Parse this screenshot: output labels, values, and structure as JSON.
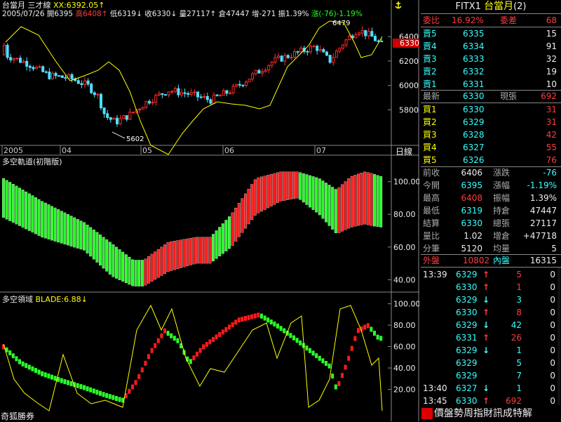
{
  "header": {
    "name": "台當月",
    "indicator": "三才線",
    "xx_label": "XX:",
    "xx_value": "6392.05",
    "date": "2005/07/26",
    "open_label": "開",
    "open": "6395",
    "high_label": "高",
    "high": "6408",
    "low_label": "低",
    "low": "6319",
    "close_label": "收",
    "close": "6330",
    "vol_label": "量",
    "vol": "27117",
    "oi_label": "倉",
    "oi": "47447",
    "oi_chg_label": "增",
    "oi_chg": "-271",
    "amp_label": "振",
    "amp": "1.39%",
    "chg_label": "漲",
    "chg": "(-76)",
    "chg_pct": "-1.19%",
    "up_arrow": "↑",
    "down_arrow": "↓"
  },
  "top_icon": "anchor-icon",
  "main_chart": {
    "y_ticks": [
      "6400",
      "6200",
      "6000",
      "5800"
    ],
    "price_tag": "6330",
    "high_note": "6479",
    "low_note": "5602",
    "x_labels": [
      "2005",
      "04",
      "05",
      "06",
      "07"
    ],
    "period_label": "日線"
  },
  "mid_chart": {
    "title": "多空軌道(初階版)",
    "y_ticks": [
      "100.00",
      "80.00",
      "60.00",
      "40.00"
    ]
  },
  "low_chart": {
    "title": "多空領域",
    "blade_label": "BLADE:6.88",
    "blade_arrow": "↓",
    "y_ticks": [
      "100.00",
      "80.00",
      "60.00",
      "40.00",
      "20.00"
    ],
    "footer": "奇狐勝券"
  },
  "quote": {
    "symbol": "FITX1",
    "name": "台當月",
    "count": "(2)",
    "ratio_label": "委比",
    "ratio": "16.92%",
    "diff_label": "委差",
    "diff": "68",
    "asks": [
      {
        "label": "賣5",
        "price": "6335",
        "vol": "15"
      },
      {
        "label": "賣4",
        "price": "6334",
        "vol": "91"
      },
      {
        "label": "賣3",
        "price": "6333",
        "vol": "32"
      },
      {
        "label": "賣2",
        "price": "6332",
        "vol": "19"
      },
      {
        "label": "賣1",
        "price": "6331",
        "vol": "10"
      }
    ],
    "last_label": "最新",
    "last": "6330",
    "now_label": "現張",
    "now": "692",
    "bids": [
      {
        "label": "買1",
        "price": "6330",
        "vol": "31"
      },
      {
        "label": "買2",
        "price": "6329",
        "vol": "31"
      },
      {
        "label": "買3",
        "price": "6328",
        "vol": "42"
      },
      {
        "label": "買4",
        "price": "6327",
        "vol": "55"
      },
      {
        "label": "買5",
        "price": "6326",
        "vol": "76"
      }
    ],
    "stats": [
      {
        "l1": "前收",
        "v1": "6406",
        "c1": "white",
        "l2": "漲跌",
        "v2": "-76",
        "c2": "cyan"
      },
      {
        "l1": "今開",
        "v1": "6395",
        "c1": "cyan",
        "l2": "漲幅",
        "v2": "-1.19%",
        "c2": "cyan"
      },
      {
        "l1": "最高",
        "v1": "6408",
        "c1": "red",
        "l2": "振幅",
        "v2": "1.39%",
        "c2": "white"
      },
      {
        "l1": "最低",
        "v1": "6319",
        "c1": "cyan",
        "l2": "持倉",
        "v2": "47447",
        "c2": "white"
      },
      {
        "l1": "結算",
        "v1": "6330",
        "c1": "cyan",
        "l2": "總張",
        "v2": "27117",
        "c2": "white"
      },
      {
        "l1": "量比",
        "v1": "1.02",
        "c1": "white",
        "l2": "增倉",
        "v2": "+47718",
        "c2": "white"
      },
      {
        "l1": "分筆",
        "v1": "5120",
        "c1": "white",
        "l2": "均量",
        "v2": "5",
        "c2": "white"
      }
    ],
    "outer_label": "外盤",
    "outer": "10802",
    "inner_label": "內盤",
    "inner": "16315"
  },
  "ticks": [
    {
      "time": "13:39",
      "price": "6329",
      "arrow": "↑",
      "vol": "5",
      "chg": "0"
    },
    {
      "time": "",
      "price": "6330",
      "arrow": "↑",
      "vol": "1",
      "chg": "0"
    },
    {
      "time": "",
      "price": "6329",
      "arrow": "↓",
      "vol": "3",
      "chg": "0"
    },
    {
      "time": "",
      "price": "6330",
      "arrow": "↑",
      "vol": "8",
      "chg": "0"
    },
    {
      "time": "",
      "price": "6329",
      "arrow": "↓",
      "vol": "42",
      "chg": "0"
    },
    {
      "time": "",
      "price": "6331",
      "arrow": "↑",
      "vol": "26",
      "chg": "0"
    },
    {
      "time": "",
      "price": "6329",
      "arrow": "↓",
      "vol": "1",
      "chg": "0"
    },
    {
      "time": "",
      "price": "6329",
      "arrow": "",
      "vol": "5",
      "chg": "0"
    },
    {
      "time": "",
      "price": "6329",
      "arrow": "",
      "vol": "7",
      "chg": "0"
    },
    {
      "time": "13:40",
      "price": "6327",
      "arrow": "↓",
      "vol": "1",
      "chg": "0"
    },
    {
      "time": "13:45",
      "price": "6330",
      "arrow": "↑",
      "vol": "692",
      "chg": "0"
    }
  ],
  "footer_banner": "價盤勢周指財訊成特解"
}
